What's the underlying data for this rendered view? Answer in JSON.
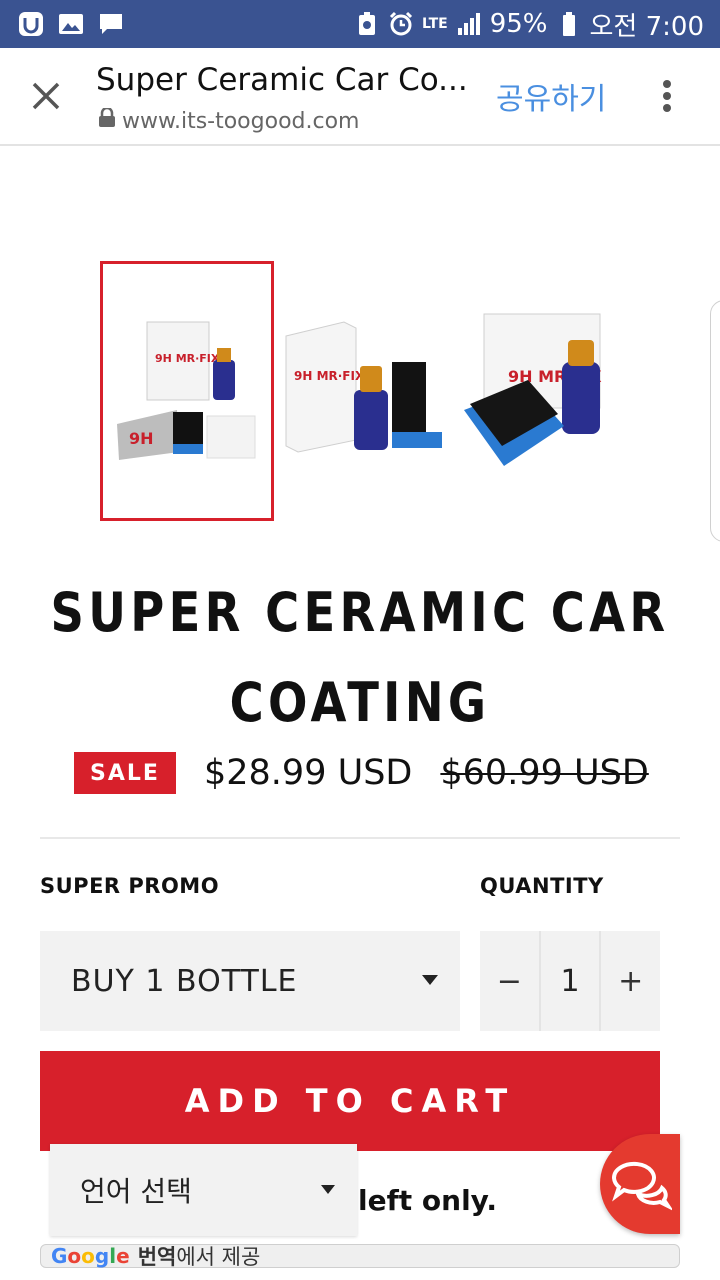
{
  "status_bar": {
    "battery": "95%",
    "time": "오전 7:00",
    "network": "LTE"
  },
  "browser": {
    "page_title": "Super Ceramic Car Co...",
    "url": "www.its-toogood.com",
    "share_label": "공유하기"
  },
  "product": {
    "title_line1": "SUPER CERAMIC CAR",
    "title_line2": "COATING",
    "sale_badge": "SALE",
    "price": "$28.99 USD",
    "compare_price": "$60.99 USD",
    "image_labels": {
      "thumb1": "9H",
      "thumb2": "9H MR·FIX",
      "thumb3": "9H MR·FIX"
    }
  },
  "options": {
    "promo_label": "SUPER PROMO",
    "promo_value": "BUY 1 BOTTLE",
    "quantity_label": "QUANTITY",
    "quantity_value": "1",
    "minus": "−",
    "plus": "+"
  },
  "cart": {
    "add_to_cart": "ADD TO CART",
    "stock_text": "left only."
  },
  "translate": {
    "language_select": "언어 선택",
    "google_letters": [
      "G",
      "o",
      "o",
      "g",
      "l",
      "e"
    ],
    "translate_word": "번역",
    "powered_suffix": "에서 제공"
  },
  "colors": {
    "status_bar": "#3a5391",
    "accent_red": "#d7202b",
    "share_blue": "#4a8fe0",
    "chat_red": "#e43a2f"
  },
  "icons": {
    "close": "close-icon",
    "lock": "lock-icon",
    "menu": "more-vert-icon",
    "chat": "chat-bubbles-icon"
  }
}
